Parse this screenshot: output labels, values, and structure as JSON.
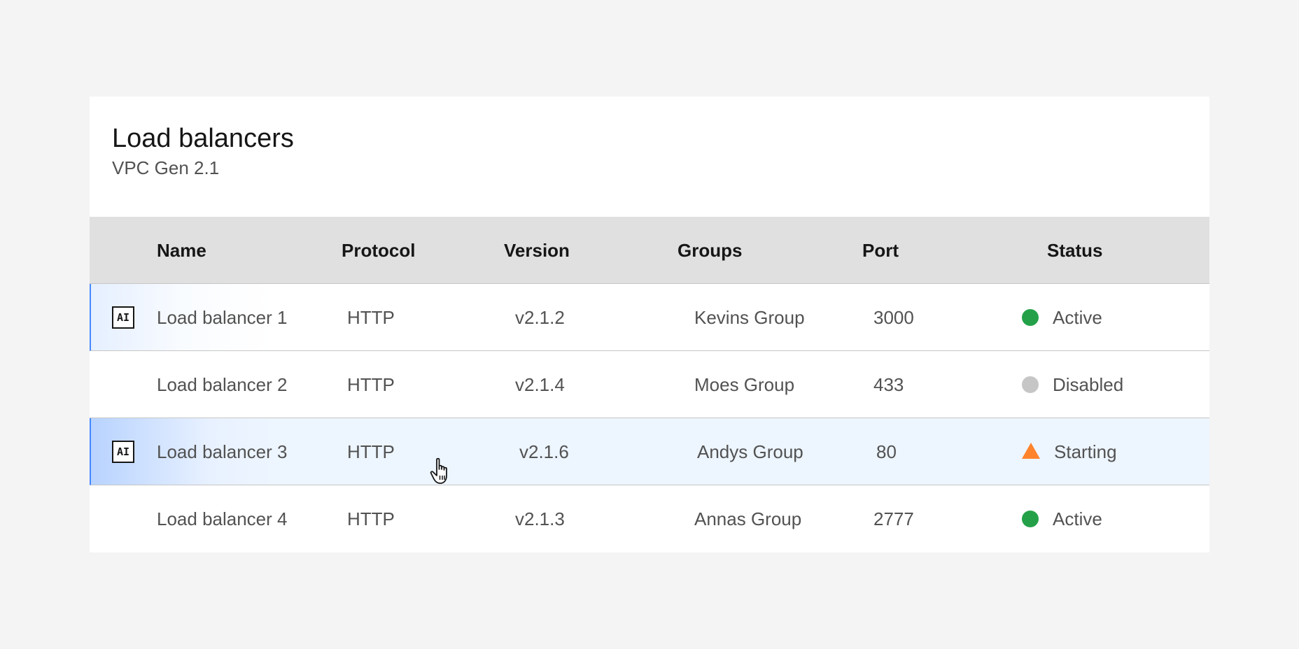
{
  "header": {
    "title": "Load balancers",
    "subtitle": "VPC Gen 2.1"
  },
  "columns": [
    "Name",
    "Protocol",
    "Version",
    "Groups",
    "Port",
    "Status"
  ],
  "ai_label": "AI",
  "rows": [
    {
      "name": "Load balancer 1",
      "protocol": "HTTP",
      "version": "v2.1.2",
      "group": "Kevins Group",
      "port": "3000",
      "status": "Active",
      "status_icon": "green-dot-icon",
      "ai": true
    },
    {
      "name": "Load balancer 2",
      "protocol": "HTTP",
      "version": "v2.1.4",
      "group": "Moes Group",
      "port": "433",
      "status": "Disabled",
      "status_icon": "gray-dot-icon",
      "ai": false
    },
    {
      "name": "Load balancer 3",
      "protocol": "HTTP",
      "version": "v2.1.6",
      "group": "Andys Group",
      "port": "80",
      "status": "Starting",
      "status_icon": "warning-triangle-icon",
      "ai": true
    },
    {
      "name": "Load balancer 4",
      "protocol": "HTTP",
      "version": "v2.1.3",
      "group": "Annas Group",
      "port": "2777",
      "status": "Active",
      "status_icon": "green-dot-icon",
      "ai": false
    }
  ],
  "colors": {
    "active": "#24a148",
    "disabled": "#c6c6c6",
    "starting": "#ff832b",
    "ai_accent": "#4589ff",
    "header_bg": "#e0e0e0"
  }
}
